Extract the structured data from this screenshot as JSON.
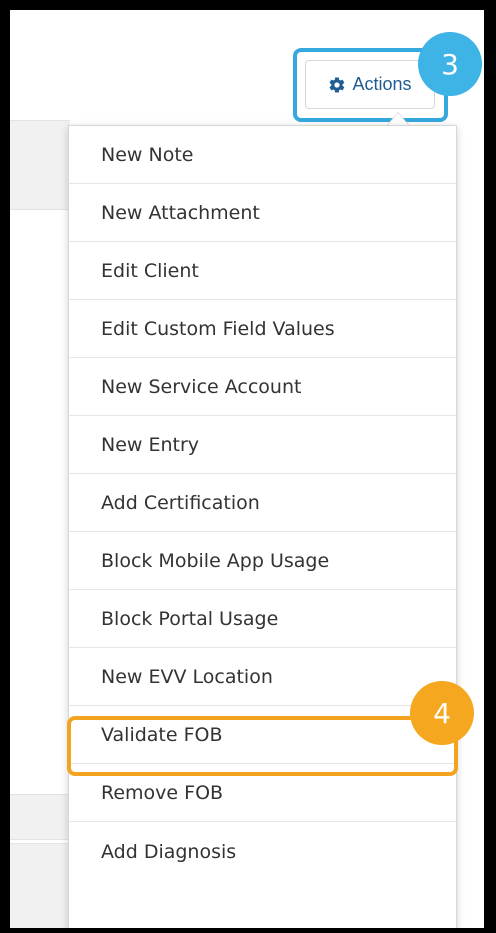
{
  "colors": {
    "page_background": "#ffffff",
    "outer_border": "#000000",
    "actions_text": "#1f5d93",
    "badge_blue": "#3eb3e5",
    "badge_orange": "#f5a81f",
    "highlight_blue": "#35a8dd",
    "highlight_orange": "#f3a31f"
  },
  "actions": {
    "icon": "gear-icon",
    "label": "Actions"
  },
  "badges": {
    "actions_step": "3",
    "remove_fob_step": "4"
  },
  "menu": {
    "items": [
      {
        "label": "New Note"
      },
      {
        "label": "New Attachment"
      },
      {
        "label": "Edit Client"
      },
      {
        "label": "Edit Custom Field Values"
      },
      {
        "label": "New Service Account"
      },
      {
        "label": "New Entry"
      },
      {
        "label": "Add Certification"
      },
      {
        "label": "Block Mobile App Usage"
      },
      {
        "label": "Block Portal Usage"
      },
      {
        "label": "New EVV Location"
      },
      {
        "label": "Validate FOB"
      },
      {
        "label": "Remove FOB"
      },
      {
        "label": "Add Diagnosis"
      }
    ]
  }
}
